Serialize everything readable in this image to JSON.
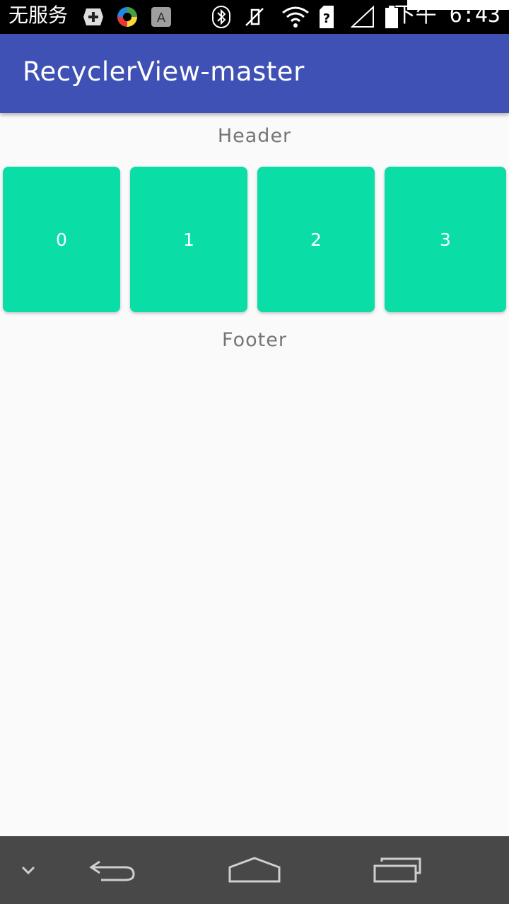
{
  "status_bar": {
    "carrier": "无服务",
    "time": "下午 6:43",
    "icons": [
      "add-icon",
      "color-wheel-app-icon",
      "font-a-icon",
      "bluetooth-icon",
      "vibrate-off-icon",
      "wifi-icon",
      "sim-unknown-icon",
      "signal-icon",
      "battery-icon"
    ]
  },
  "app_bar": {
    "title": "RecyclerView-master",
    "color": "#3f51b5"
  },
  "list": {
    "header": "Header",
    "footer": "Footer",
    "items": [
      "0",
      "1",
      "2",
      "3"
    ],
    "item_color": "#0adda6"
  },
  "nav_bar": {
    "icons": [
      "chevron-down-icon",
      "back-icon",
      "home-icon",
      "recents-icon"
    ]
  }
}
